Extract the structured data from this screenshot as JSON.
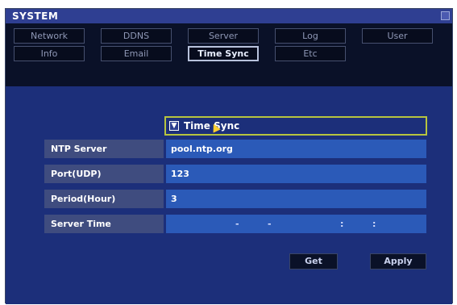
{
  "window": {
    "title": "SYSTEM"
  },
  "tabs": [
    {
      "label": "Network"
    },
    {
      "label": "DDNS"
    },
    {
      "label": "Server"
    },
    {
      "label": "Log"
    },
    {
      "label": "User"
    },
    {
      "label": "Info"
    },
    {
      "label": "Email"
    },
    {
      "label": "Time Sync",
      "active": true
    },
    {
      "label": "Etc"
    }
  ],
  "time_sync": {
    "checkbox_label": "Time Sync",
    "checkbox_checked": true,
    "fields": [
      {
        "label": "NTP Server",
        "value": "pool.ntp.org"
      },
      {
        "label": "Port(UDP)",
        "value": "123"
      },
      {
        "label": "Period(Hour)",
        "value": "3"
      },
      {
        "label": "Server Time",
        "value": ""
      }
    ],
    "server_time_separators": [
      "-",
      "-",
      ":",
      ":"
    ]
  },
  "buttons": {
    "get": "Get",
    "apply": "Apply"
  },
  "colors": {
    "titlebar": "#2f3f92",
    "content_bg": "#1c2f7a",
    "value_bg": "#2b5ab8",
    "label_bg": "#3f4c7f",
    "focus_border": "#b7c43f"
  }
}
